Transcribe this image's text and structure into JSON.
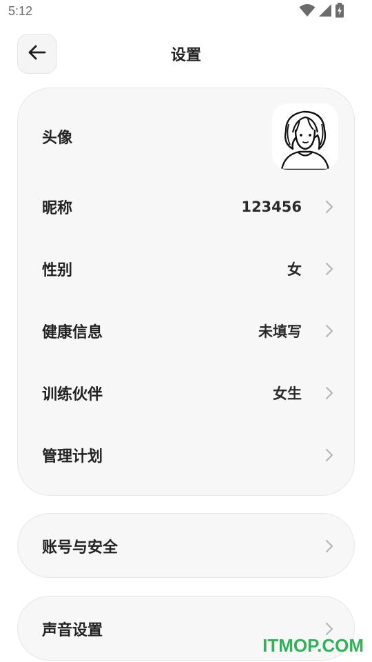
{
  "status_bar": {
    "time": "5:12",
    "icons": [
      "wifi-icon",
      "cellular-signal-icon",
      "battery-charging-icon"
    ]
  },
  "header": {
    "back_icon": "arrow-left-icon",
    "title": "设置"
  },
  "profile": {
    "avatar_label": "头像",
    "rows": [
      {
        "label": "昵称",
        "value": "123456"
      },
      {
        "label": "性别",
        "value": "女"
      },
      {
        "label": "健康信息",
        "value": "未填写"
      },
      {
        "label": "训练伙伴",
        "value": "女生"
      },
      {
        "label": "管理计划",
        "value": ""
      }
    ]
  },
  "account": {
    "label": "账号与安全"
  },
  "sound": {
    "label": "声音设置"
  },
  "watermark": "ITMOP.COM",
  "colors": {
    "card_background": "#f7f7f7",
    "card_border": "#e6e6e6",
    "chevron": "#b5b5b5",
    "watermark": "#2fb25a"
  }
}
